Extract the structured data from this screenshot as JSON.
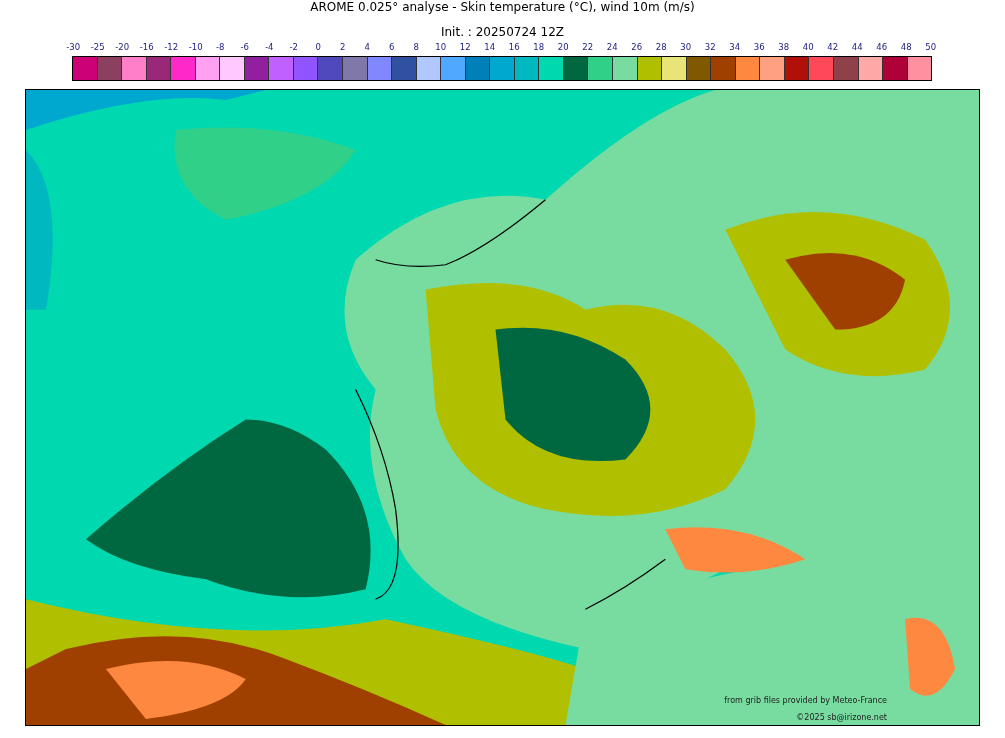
{
  "title": "AROME 0.025° analyse - Skin temperature (°C), wind 10m (m/s)",
  "subtitle": "Init. : 20250724 12Z",
  "legend": {
    "ticks": [
      "-30",
      "-25",
      "-20",
      "-16",
      "-12",
      "-10",
      "-8",
      "-6",
      "-4",
      "-2",
      "0",
      "2",
      "4",
      "6",
      "8",
      "10",
      "12",
      "14",
      "16",
      "18",
      "20",
      "22",
      "24",
      "26",
      "28",
      "30",
      "32",
      "34",
      "36",
      "38",
      "40",
      "42",
      "44",
      "46",
      "48",
      "50"
    ],
    "swatches": [
      {
        "color": "#cc0077"
      },
      {
        "color": "#8c4060"
      },
      {
        "color": "#ff80c8"
      },
      {
        "color": "#9a2878"
      },
      {
        "color": "#ff28c8"
      },
      {
        "color": "#ffa0f0"
      },
      {
        "color": "#ffc8ff"
      },
      {
        "color": "#9020a0"
      },
      {
        "color": "#c060ff"
      },
      {
        "color": "#9055ff"
      },
      {
        "color": "#5048bd"
      },
      {
        "color": "#8078a8"
      },
      {
        "color": "#8088ff"
      },
      {
        "color": "#3050a0"
      },
      {
        "color": "#b0c8ff"
      },
      {
        "color": "#50a8ff"
      },
      {
        "color": "#0080b8"
      },
      {
        "color": "#00a8d0"
      },
      {
        "color": "#00b8c0"
      },
      {
        "color": "#00d8b0"
      },
      {
        "color": "#006840"
      },
      {
        "color": "#30d088"
      },
      {
        "color": "#78dca0"
      },
      {
        "color": "#b0c000"
      },
      {
        "color": "#e8e478"
      },
      {
        "color": "#805800"
      },
      {
        "color": "#a04000"
      },
      {
        "color": "#ff8840"
      },
      {
        "color": "#ffa080"
      },
      {
        "color": "#b01008"
      },
      {
        "color": "#ff4858"
      },
      {
        "color": "#904048"
      },
      {
        "color": "#ffa8a8"
      },
      {
        "color": "#b00038"
      },
      {
        "color": "#ff90a0"
      }
    ]
  },
  "credits": [
    "from grib files provided by Meteo-France",
    "©2025 sb@irizone.net"
  ]
}
